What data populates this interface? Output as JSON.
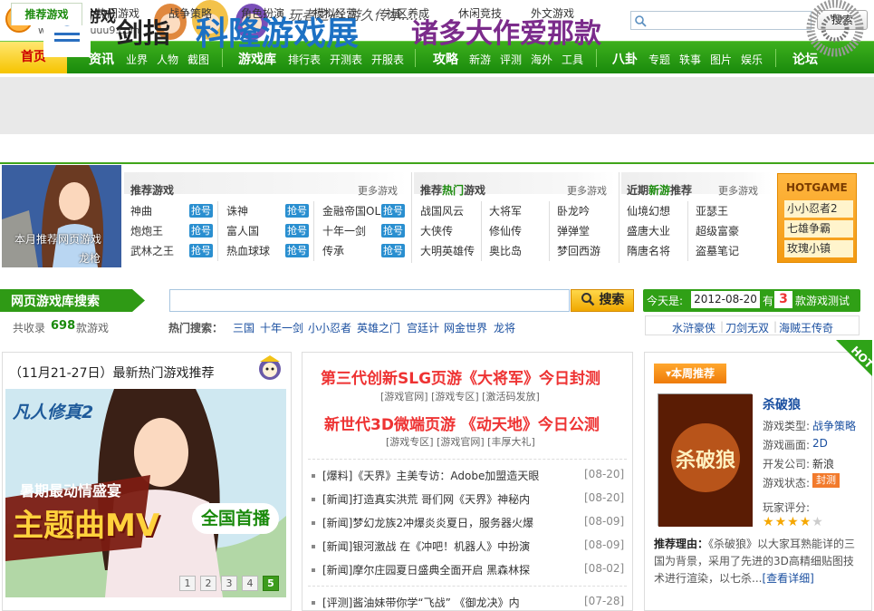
{
  "header": {
    "site_name": "网页游戏",
    "site_url": "webgame.uuu9.com",
    "slogan": "玩者之心 游久传承......",
    "search_placeholder": "",
    "search_button": "搜索"
  },
  "nav": {
    "home": "首页",
    "groups": [
      {
        "main": "资讯",
        "subs": [
          "业界",
          "人物",
          "截图"
        ]
      },
      {
        "main": "游戏库",
        "subs": [
          "排行表",
          "开测表",
          "开服表"
        ]
      },
      {
        "main": "攻略",
        "subs": [
          "新游",
          "评测",
          "海外",
          "工具"
        ]
      },
      {
        "main": "八卦",
        "subs": [
          "专题",
          "轶事",
          "图片",
          "娱乐"
        ]
      },
      {
        "main": "论坛",
        "subs": []
      }
    ]
  },
  "banner": {
    "part1": "剑指",
    "part2": "科隆游戏展",
    "part3": "诸多大作爱那款",
    "logo_text": "republic of korea"
  },
  "tabs": {
    "active": "推荐游戏",
    "items": [
      "热门游戏",
      "战争策略",
      "角色扮演",
      "模拟经营",
      "社区养成",
      "休闲竞技",
      "外文游戏"
    ]
  },
  "feature": {
    "line1": "本月推荐网页游戏",
    "line2": "龙枪"
  },
  "recommend": {
    "title": "推荐游戏",
    "more": "更多游戏",
    "badge": "抢号",
    "col1": [
      "神曲",
      "炮炮王",
      "武林之王"
    ],
    "col2": [
      "诛神",
      "富人国",
      "热血球球"
    ],
    "col3": [
      "金融帝国OL",
      "十年一剑",
      "传承"
    ]
  },
  "hot": {
    "title_prefix": "推荐",
    "title_highlight": "热门",
    "title_suffix": "游戏",
    "more": "更多游戏",
    "col1": [
      "战国风云",
      "大侠传",
      "大明英雄传"
    ],
    "col2": [
      "大将军",
      "修仙传",
      "奥比岛"
    ],
    "col3": [
      "卧龙吟",
      "弹弹堂",
      "梦回西游"
    ]
  },
  "newgames": {
    "title_prefix": "近期",
    "title_highlight": "新游",
    "title_suffix": "推荐",
    "more": "更多游戏",
    "col1": [
      "仙境幻想",
      "盛唐大业",
      "隋唐名将"
    ],
    "col2": [
      "亚瑟王",
      "超级富豪",
      "盗墓笔记"
    ]
  },
  "hotgame": {
    "title": "HOTGAME",
    "items": [
      "小小忍者2",
      "七雄争霸",
      "玫瑰小镇"
    ]
  },
  "library": {
    "title": "网页游戏库搜索",
    "search_button": "搜索",
    "total_prefix": "共收录",
    "total": "698",
    "total_suffix": "款游戏",
    "hot_label": "热门搜索：",
    "hot_keywords": [
      "三国",
      "十年一剑",
      "小小忍者",
      "英雄之门",
      "宫廷计",
      "网金世界",
      "龙将"
    ]
  },
  "today": {
    "label": "今天是:",
    "date": "2012-08-20",
    "has": "有",
    "count": "3",
    "tail": "款游戏测试",
    "tests": [
      "水浒豪侠",
      "刀剑无双",
      "海贼王传奇"
    ]
  },
  "left_panel": {
    "title": "（11月21-27日）最新热门游戏推荐",
    "promo_logo": "凡人修真2",
    "promo_line1": "暑期最动情盛宴",
    "promo_line2": "主题曲MV",
    "promo_line3": "全国首播",
    "pages": [
      "1",
      "2",
      "3",
      "4",
      "5"
    ],
    "active_page": "5"
  },
  "middle_panel": {
    "headline1": "第三代创新SLG页游《大将军》今日封测",
    "sub1": "[游戏官网] [游戏专区] [激活码发放]",
    "headline2": "新世代3D微端页游 《动天地》今日公测",
    "sub2": "[游戏专区] [游戏官网] [丰厚大礼]",
    "news": [
      {
        "text": "[爆料]《天界》主美专访：Adobe加盟造天眼",
        "date": "[08-20]"
      },
      {
        "text": "[新闻]打造真实洪荒 哥们网《天界》神秘内",
        "date": "[08-20]"
      },
      {
        "text": "[新闻]梦幻龙族2冲爆炎炎夏日，服务器火爆",
        "date": "[08-09]"
      },
      {
        "text": "[新闻]银河激战 在《冲吧！机器人》中扮演",
        "date": "[08-09]"
      },
      {
        "text": "[新闻]摩尔庄园夏日盛典全面开启 黑森林探",
        "date": "[08-02]"
      },
      {
        "text": "[评测]酱油妹带你学“飞战” 《御龙决》内",
        "date": "[07-28]"
      }
    ]
  },
  "right_panel": {
    "tag": "本周推荐",
    "hot": "HOT",
    "cover_text": "杀破狼",
    "game_name": "杀破狼",
    "type_label": "游戏类型:",
    "type": "战争策略",
    "graphic_label": "游戏画面:",
    "graphic": "2D",
    "dev_label": "开发公司:",
    "dev": "新浪",
    "status_label": "游戏状态:",
    "status": "封测",
    "score_label": "玩家评分:",
    "score": 4,
    "score_max": 5,
    "reason_label": "推荐理由：",
    "reason": "《杀破狼》以大家耳熟能详的三国为背景，采用了先进的3D高精细贴图技术进行渲染，以七杀...",
    "reason_more": "[查看详细]"
  },
  "colors": {
    "nav_green": "#1a8a0c",
    "accent_red": "#e33",
    "badge_blue": "#2a8fd0",
    "hot_orange": "#f39a12"
  }
}
